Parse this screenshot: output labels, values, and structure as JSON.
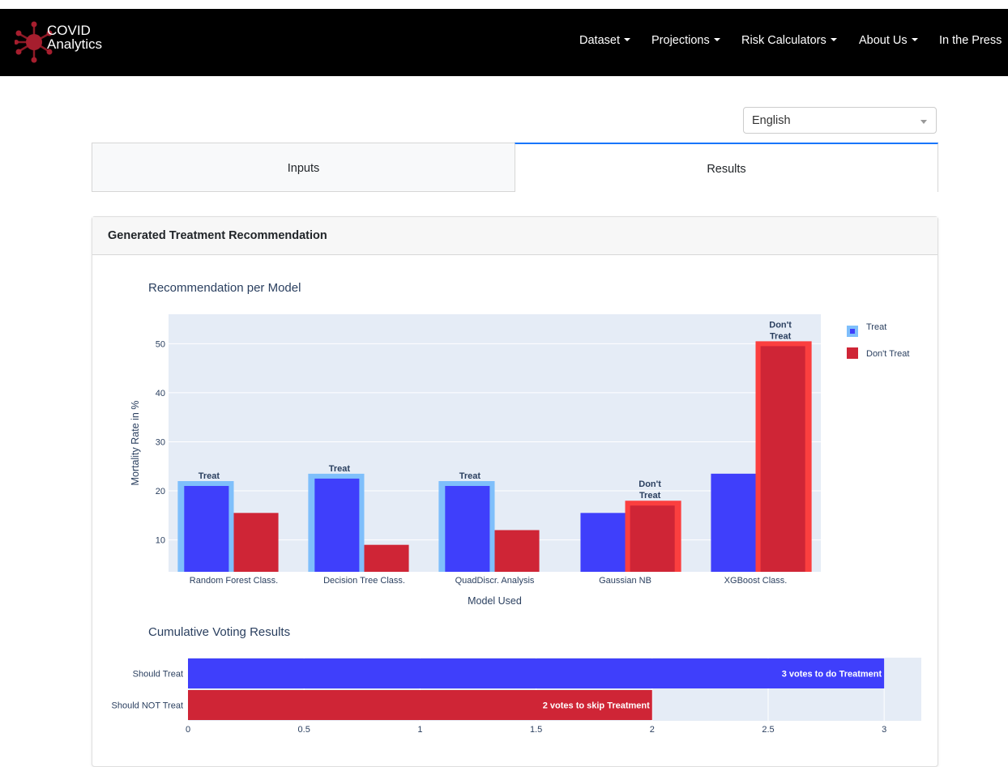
{
  "navbar": {
    "logo_line1": "COVID",
    "logo_line2": "Analytics",
    "items": [
      {
        "label": "Dataset",
        "dropdown": true
      },
      {
        "label": "Projections",
        "dropdown": true
      },
      {
        "label": "Risk Calculators",
        "dropdown": true
      },
      {
        "label": "About Us",
        "dropdown": true
      },
      {
        "label": "In the Press",
        "dropdown": false
      }
    ]
  },
  "language": {
    "selected": "English"
  },
  "tabs": [
    {
      "label": "Inputs",
      "active": false
    },
    {
      "label": "Results",
      "active": true
    }
  ],
  "card": {
    "title": "Generated Treatment Recommendation"
  },
  "colors": {
    "treat": "#3f3ffb",
    "dont_treat": "#cf2536",
    "treat_highlight": "#7fbffb",
    "dont_treat_highlight": "#fb3f3f",
    "plot_bg": "#e5ecf6",
    "axis_text": "#2a3f5f"
  },
  "chart_data": [
    {
      "type": "bar",
      "title": "Recommendation per Model",
      "xlabel": "Model Used",
      "ylabel": "Mortality Rate in %",
      "categories": [
        "Random Forest Class.",
        "Decision Tree Class.",
        "QuadDiscr. Analysis",
        "Gaussian NB",
        "XGBoost Class."
      ],
      "series": [
        {
          "name": "Treat",
          "values": [
            21.0,
            22.5,
            21.0,
            15.5,
            23.5
          ]
        },
        {
          "name": "Don't Treat",
          "values": [
            15.5,
            9.0,
            12.0,
            17.0,
            49.5
          ]
        }
      ],
      "recommended": [
        "Treat",
        "Treat",
        "Treat",
        "Don't Treat",
        "Don't Treat"
      ],
      "annotation_labels": [
        "Treat",
        "Treat",
        "Treat",
        "Don't Treat",
        "Don't Treat"
      ],
      "ylim": [
        3.5,
        56
      ],
      "yticks": [
        10,
        20,
        30,
        40,
        50
      ],
      "grid": true,
      "legend": "top-right"
    },
    {
      "type": "bar",
      "orientation": "horizontal",
      "title": "Cumulative Voting Results",
      "categories": [
        "Should Treat",
        "Should NOT Treat"
      ],
      "values": [
        3,
        2
      ],
      "data_labels": [
        "3 votes to do Treatment",
        "2 votes to skip Treatment"
      ],
      "xlim": [
        0,
        3.16
      ],
      "xticks": [
        "0",
        "0.5",
        "1",
        "1.5",
        "2",
        "2.5",
        "3"
      ],
      "legend": "none"
    }
  ]
}
